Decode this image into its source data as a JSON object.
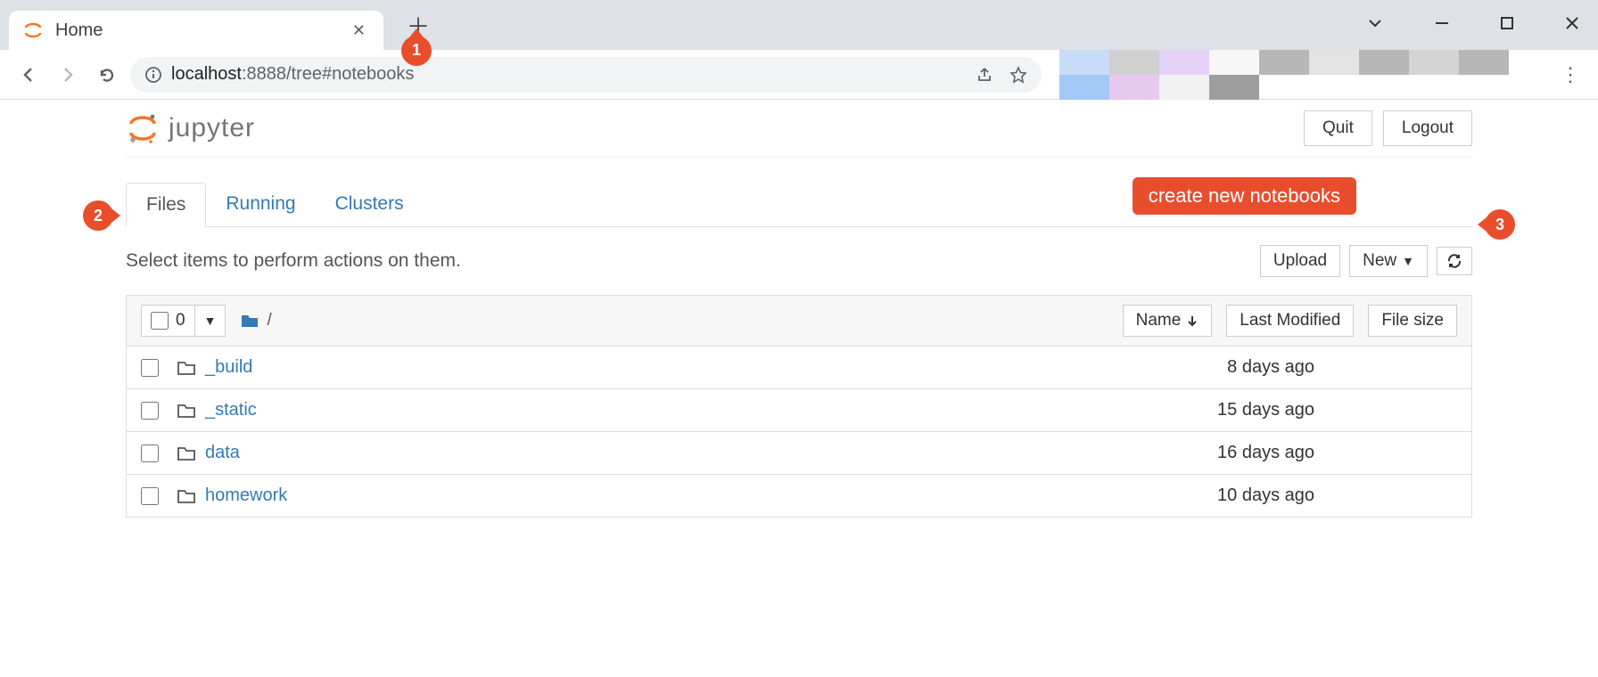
{
  "browser": {
    "tab_title": "Home",
    "url_host": "localhost",
    "url_path": ":8888/tree#notebooks",
    "ext_colors": [
      "#c8dcf8",
      "#d0d0d0",
      "#e3d1f7",
      "#f7f7f7",
      "#b7b7b7",
      "#e3e3e3",
      "#b7b7b7",
      "#d4d4d4",
      "#b7b7b7",
      "#a3c8f5",
      "#e7c9ef",
      "#f2f2f2",
      "#9e9e9e"
    ]
  },
  "annotations": {
    "a1": "1",
    "a2": "2",
    "a3": "3",
    "label_new": "create new notebooks"
  },
  "jupyter": {
    "logo_text": "jupyter",
    "btn_quit": "Quit",
    "btn_logout": "Logout",
    "tabs": {
      "files": "Files",
      "running": "Running",
      "clusters": "Clusters"
    },
    "help_text": "Select items to perform actions on them.",
    "upload_label": "Upload",
    "new_label": "New",
    "select_count": "0",
    "breadcrumb_root": "/",
    "sort_name": "Name",
    "sort_modified": "Last Modified",
    "sort_size": "File size",
    "files": [
      {
        "name": "_build",
        "modified": "8 days ago"
      },
      {
        "name": "_static",
        "modified": "15 days ago"
      },
      {
        "name": "data",
        "modified": "16 days ago"
      },
      {
        "name": "homework",
        "modified": "10 days ago"
      }
    ]
  }
}
